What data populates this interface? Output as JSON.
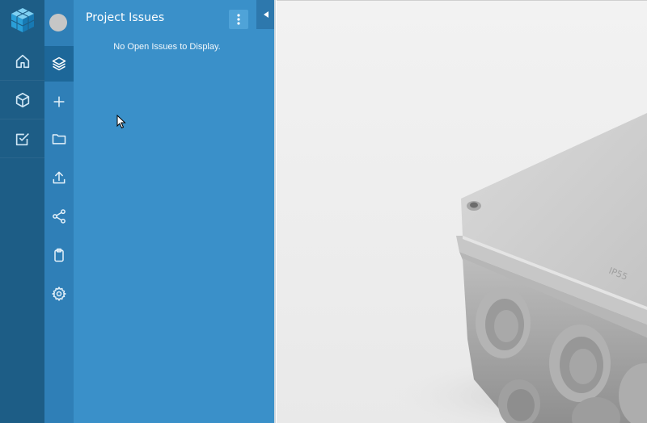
{
  "app": {
    "brand_color": "#1d5d86",
    "panel_color": "#3a90c9"
  },
  "rail": {
    "items": [
      {
        "name": "home",
        "icon": "home-icon"
      },
      {
        "name": "models",
        "icon": "cube-icon"
      },
      {
        "name": "tasks",
        "icon": "checkbox-icon"
      }
    ]
  },
  "tools": {
    "items": [
      {
        "name": "layers",
        "icon": "layers-icon",
        "active": true
      },
      {
        "name": "add",
        "icon": "plus-icon"
      },
      {
        "name": "folder",
        "icon": "folder-icon"
      },
      {
        "name": "upload",
        "icon": "upload-icon"
      },
      {
        "name": "share",
        "icon": "share-icon"
      },
      {
        "name": "clipboard",
        "icon": "clipboard-icon"
      },
      {
        "name": "settings",
        "icon": "gear-icon"
      }
    ]
  },
  "issues_panel": {
    "title": "Project Issues",
    "empty_message": "No Open Issues to Display."
  },
  "viewport": {
    "model_text": "IP55"
  }
}
